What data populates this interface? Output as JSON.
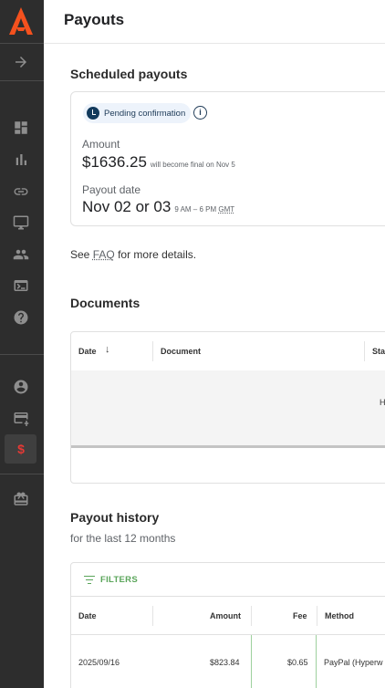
{
  "page": {
    "title": "Payouts"
  },
  "scheduled": {
    "heading": "Scheduled payouts",
    "status_chip": "Pending confirmation",
    "amount_label": "Amount",
    "amount_value": "$1636.25",
    "amount_note": "will become final on Nov 5",
    "date_label": "Payout date",
    "date_value": "Nov 02 or 03",
    "time_range": "9 AM – 6 PM",
    "timezone": "GMT"
  },
  "faq": {
    "prefix": "See",
    "link": "FAQ",
    "suffix": "for more details."
  },
  "documents": {
    "heading": "Documents",
    "columns": [
      "Date",
      "Document",
      "Sta"
    ],
    "empty_text_partial": "H"
  },
  "history": {
    "heading": "Payout history",
    "subtitle": "for the last 12 months",
    "filters_label": "FILTERS",
    "columns": [
      "Date",
      "Amount",
      "Fee",
      "Method"
    ],
    "rows": [
      {
        "date": "2025/09/16",
        "amount": "$823.84",
        "fee": "$0.65",
        "method": "PayPal (Hyperw"
      }
    ]
  },
  "sidebar": {
    "icons": [
      "arrow-right-icon",
      "dashboard-icon",
      "bar-chart-icon",
      "link-icon",
      "monitor-icon",
      "people-icon",
      "terminal-icon",
      "help-icon",
      "account-circle-icon",
      "credit-card-icon",
      "dollar-icon",
      "gift-icon"
    ],
    "active": "dollar-icon"
  },
  "colors": {
    "sidebar": "#2d2d2d",
    "accent_red": "#e53935",
    "filters_green": "#5aa55a"
  }
}
